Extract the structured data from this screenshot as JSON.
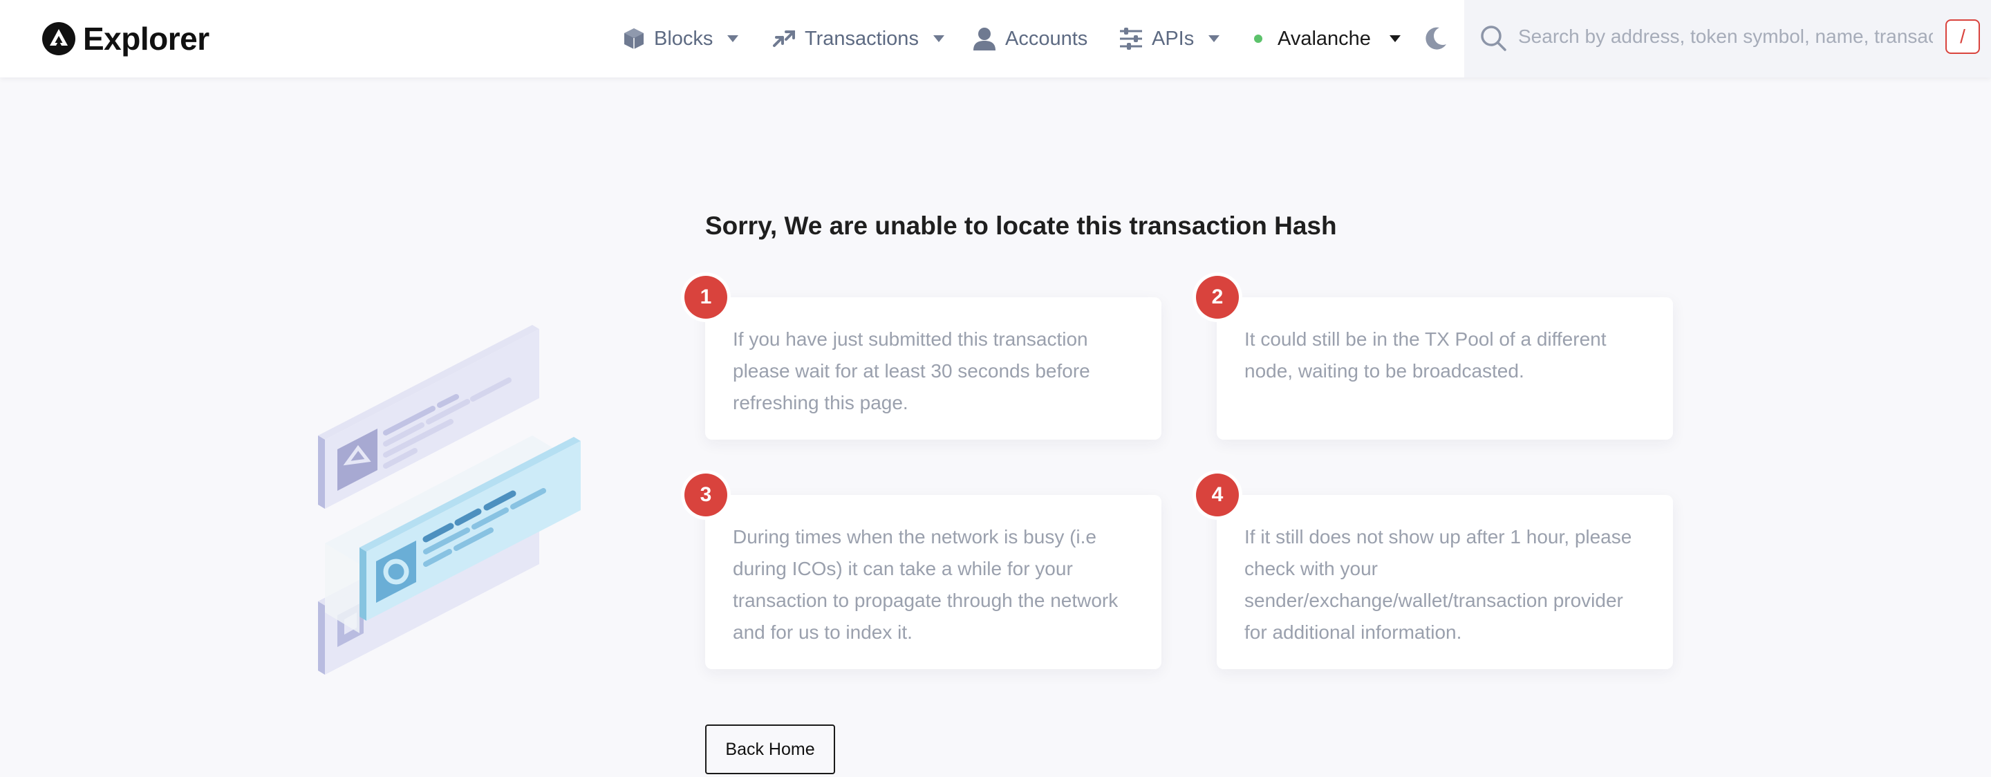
{
  "header": {
    "brand": "Explorer",
    "nav": [
      {
        "label": "Blocks",
        "icon": "cube-icon"
      },
      {
        "label": "Transactions",
        "icon": "arrows-exchange-icon"
      },
      {
        "label": "Accounts",
        "icon": "user-icon"
      },
      {
        "label": "APIs",
        "icon": "sliders-icon"
      }
    ],
    "network": {
      "label": "Avalanche",
      "status_color": "#5cc26b"
    },
    "search": {
      "placeholder": "Search by address, token symbol, name, transaction hash, or block number",
      "shortcut": "/"
    }
  },
  "main": {
    "title": "Sorry, We are unable to locate this transaction Hash",
    "reasons": [
      {
        "number": "1",
        "text": "If you have just submitted this transaction please wait for at least 30 seconds before refreshing this page."
      },
      {
        "number": "2",
        "text": "It could still be in the TX Pool of a different node, waiting to be broadcasted."
      },
      {
        "number": "3",
        "text": "During times when the network is busy (i.e during ICOs) it can take a while for your transaction to propagate through the network and for us to index it."
      },
      {
        "number": "4",
        "text": "If it still does not show up after 1 hour, please check with your sender/exchange/wallet/transaction provider for additional information."
      }
    ],
    "back_button": "Back Home"
  },
  "colors": {
    "accent": "#d9433d",
    "nav_text": "#5d6a82",
    "muted_text": "#9aa0ad",
    "background": "#f8f8fb"
  }
}
